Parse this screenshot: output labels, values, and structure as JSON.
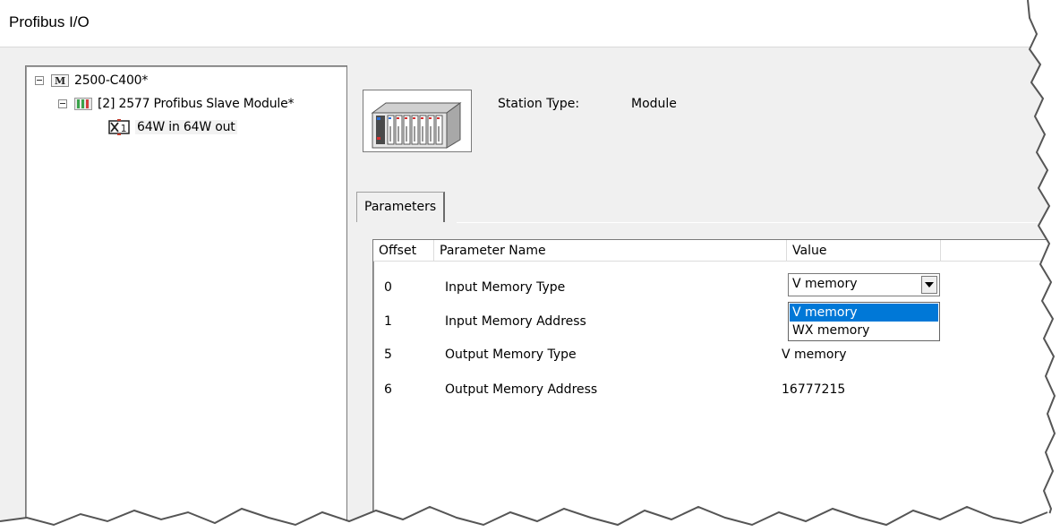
{
  "window": {
    "title": "Profibus I/O"
  },
  "tree": {
    "items": [
      {
        "label": "2500-C400*",
        "icon": "module-m-icon"
      },
      {
        "label": "[2] 2577 Profibus Slave Module*",
        "icon": "slave-module-icon"
      },
      {
        "label": "64W in 64W out",
        "icon": "io-x1-icon"
      }
    ]
  },
  "station": {
    "type_label": "Station Type:",
    "type_value": "Module",
    "image": "rack-module-icon"
  },
  "tabs": [
    {
      "label": "Parameters"
    }
  ],
  "table": {
    "columns": [
      "Offset",
      "Parameter Name",
      "Value"
    ],
    "rows": [
      {
        "offset": "0",
        "name": "Input Memory Type",
        "value": "V memory"
      },
      {
        "offset": "1",
        "name": "Input Memory Address",
        "value": ""
      },
      {
        "offset": "5",
        "name": "Output Memory Type",
        "value": "V memory"
      },
      {
        "offset": "6",
        "name": "Output Memory Address",
        "value": "16777215"
      }
    ]
  },
  "combo": {
    "value": "V memory",
    "options": [
      "V memory",
      "WX memory"
    ],
    "selected_index": 0
  },
  "colors": {
    "selection": "#0078d7",
    "window_bg": "#f0f0f0"
  }
}
